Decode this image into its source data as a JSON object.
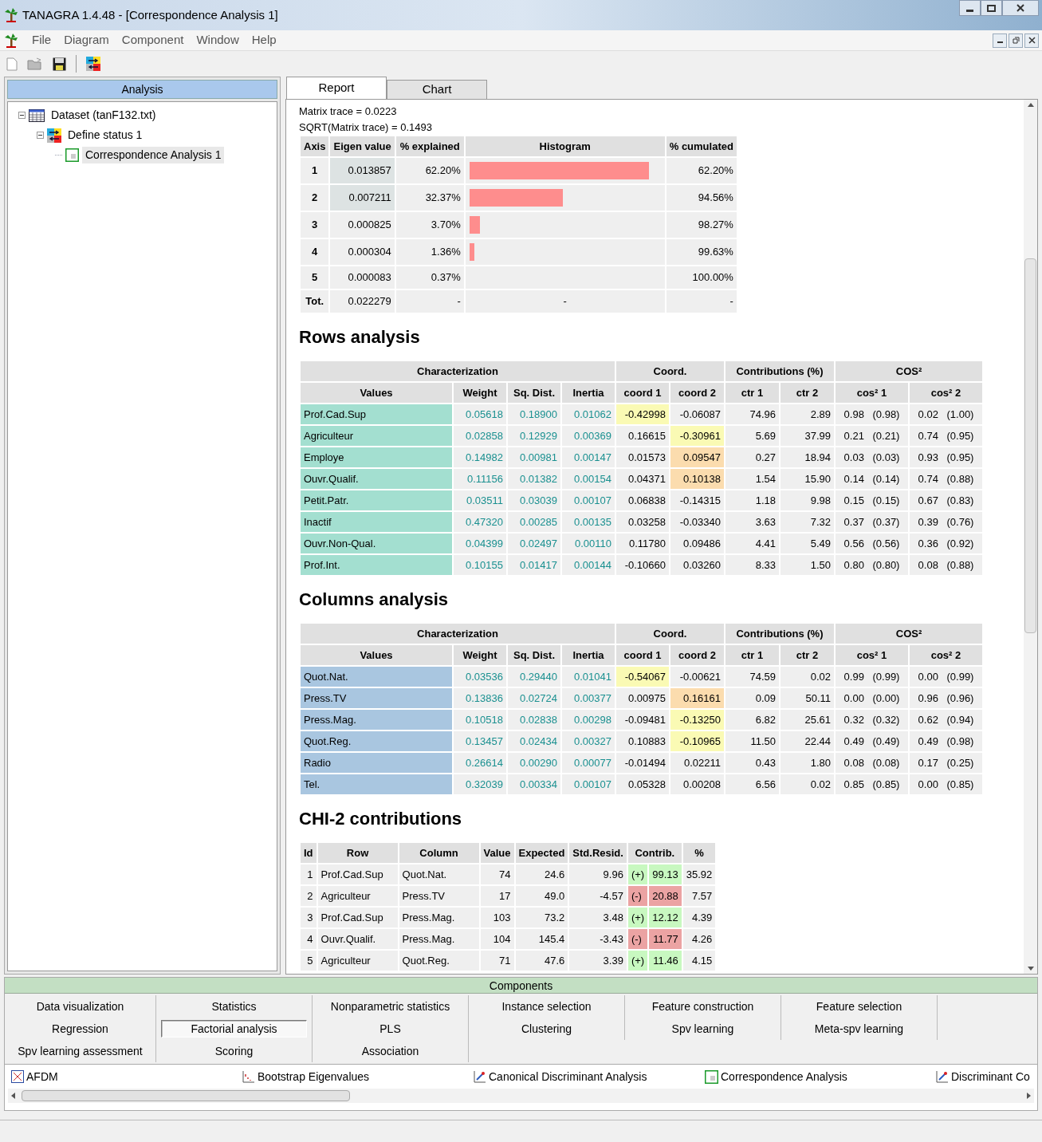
{
  "window": {
    "title": "TANAGRA 1.4.48 - [Correspondence Analysis 1]"
  },
  "menu": [
    "File",
    "Diagram",
    "Component",
    "Window",
    "Help"
  ],
  "tree": {
    "header": "Analysis",
    "items": [
      {
        "label": "Dataset (tanF132.txt)",
        "kind": "dataset",
        "selected": false,
        "expanded": true,
        "children": [
          {
            "label": "Define status 1",
            "kind": "status",
            "selected": false,
            "expanded": true,
            "children": [
              {
                "label": "Correspondence Analysis 1",
                "kind": "component",
                "selected": true
              }
            ]
          }
        ]
      }
    ]
  },
  "tabs": [
    {
      "label": "Report",
      "selected": true
    },
    {
      "label": "Chart",
      "selected": false
    }
  ],
  "report": {
    "trace_lines": [
      "Matrix trace = 0.0223",
      "SQRT(Matrix trace) = 0.1493"
    ],
    "eigen_table": {
      "columns": [
        "Axis",
        "Eigen value",
        "% explained",
        "Histogram",
        "% cumulated"
      ],
      "rows": [
        {
          "axis": "1",
          "eigen": "0.013857",
          "explained": "62.20%",
          "level": 0.94,
          "cumulated": "62.20%",
          "highlighted": true
        },
        {
          "axis": "2",
          "eigen": "0.007211",
          "explained": "32.37%",
          "level": 0.49,
          "cumulated": "94.56%",
          "highlighted": true
        },
        {
          "axis": "3",
          "eigen": "0.000825",
          "explained": "3.70%",
          "level": 0.056,
          "cumulated": "98.27%",
          "highlighted": false
        },
        {
          "axis": "4",
          "eigen": "0.000304",
          "explained": "1.36%",
          "level": 0.025,
          "cumulated": "99.63%",
          "highlighted": false
        },
        {
          "axis": "5",
          "eigen": "0.000083",
          "explained": "0.37%",
          "cumulated": "100.00%",
          "highlighted": false
        },
        {
          "axis": "Tot.",
          "eigen": "0.022279",
          "explained": "-",
          "histogram": "-",
          "cumulated": "-",
          "highlighted": false
        }
      ]
    },
    "analyses": [
      {
        "title": "Rows analysis",
        "kind": "rows",
        "groups": [
          "Characterization",
          "Coord.",
          "Contributions (%)",
          "COS²"
        ],
        "columns": [
          "Values",
          "Weight",
          "Sq. Dist.",
          "Inertia",
          "coord 1",
          "coord 2",
          "ctr 1",
          "ctr 2",
          "cos² 1",
          "cos² 2"
        ],
        "rows": [
          {
            "value": "Prof.Cad.Sup",
            "weight": "0.05618",
            "sq_dist": "0.18900",
            "inertia": "0.01062",
            "coord1": {
              "text": "-0.42998",
              "color": "#fafab4"
            },
            "coord2": {
              "text": "-0.06087"
            },
            "ctr1": "74.96",
            "ctr2": "2.89",
            "cos1": "0.98 (0.98)",
            "cos2": "0.02 (1.00)"
          },
          {
            "value": "Agriculteur",
            "weight": "0.02858",
            "sq_dist": "0.12929",
            "inertia": "0.00369",
            "coord1": {
              "text": "0.16615"
            },
            "coord2": {
              "text": "-0.30961",
              "color": "#fafab4"
            },
            "ctr1": "5.69",
            "ctr2": "37.99",
            "cos1": "0.21 (0.21)",
            "cos2": "0.74 (0.95)"
          },
          {
            "value": "Employe",
            "weight": "0.14982",
            "sq_dist": "0.00981",
            "inertia": "0.00147",
            "coord1": {
              "text": "0.01573"
            },
            "coord2": {
              "text": "0.09547",
              "color": "#fbdcae"
            },
            "ctr1": "0.27",
            "ctr2": "18.94",
            "cos1": "0.03 (0.03)",
            "cos2": "0.93 (0.95)"
          },
          {
            "value": "Ouvr.Qualif.",
            "weight": "0.11156",
            "sq_dist": "0.01382",
            "inertia": "0.00154",
            "coord1": {
              "text": "0.04371"
            },
            "coord2": {
              "text": "0.10138",
              "color": "#fbdcae"
            },
            "ctr1": "1.54",
            "ctr2": "15.90",
            "cos1": "0.14 (0.14)",
            "cos2": "0.74 (0.88)"
          },
          {
            "value": "Petit.Patr.",
            "weight": "0.03511",
            "sq_dist": "0.03039",
            "inertia": "0.00107",
            "coord1": {
              "text": "0.06838"
            },
            "coord2": {
              "text": "-0.14315"
            },
            "ctr1": "1.18",
            "ctr2": "9.98",
            "cos1": "0.15 (0.15)",
            "cos2": "0.67 (0.83)"
          },
          {
            "value": "Inactif",
            "weight": "0.47320",
            "sq_dist": "0.00285",
            "inertia": "0.00135",
            "coord1": {
              "text": "0.03258"
            },
            "coord2": {
              "text": "-0.03340"
            },
            "ctr1": "3.63",
            "ctr2": "7.32",
            "cos1": "0.37 (0.37)",
            "cos2": "0.39 (0.76)"
          },
          {
            "value": "Ouvr.Non-Qual.",
            "weight": "0.04399",
            "sq_dist": "0.02497",
            "inertia": "0.00110",
            "coord1": {
              "text": "0.11780"
            },
            "coord2": {
              "text": "0.09486"
            },
            "ctr1": "4.41",
            "ctr2": "5.49",
            "cos1": "0.56 (0.56)",
            "cos2": "0.36 (0.92)"
          },
          {
            "value": "Prof.Int.",
            "weight": "0.10155",
            "sq_dist": "0.01417",
            "inertia": "0.00144",
            "coord1": {
              "text": "-0.10660"
            },
            "coord2": {
              "text": "0.03260"
            },
            "ctr1": "8.33",
            "ctr2": "1.50",
            "cos1": "0.80 (0.80)",
            "cos2": "0.08 (0.88)"
          }
        ]
      },
      {
        "title": "Columns analysis",
        "kind": "columns",
        "groups": [
          "Characterization",
          "Coord.",
          "Contributions (%)",
          "COS²"
        ],
        "columns": [
          "Values",
          "Weight",
          "Sq. Dist.",
          "Inertia",
          "coord 1",
          "coord 2",
          "ctr 1",
          "ctr 2",
          "cos² 1",
          "cos² 2"
        ],
        "rows": [
          {
            "value": "Quot.Nat.",
            "weight": "0.03536",
            "sq_dist": "0.29440",
            "inertia": "0.01041",
            "coord1": {
              "text": "-0.54067",
              "color": "#fafab4"
            },
            "coord2": {
              "text": "-0.00621"
            },
            "ctr1": "74.59",
            "ctr2": "0.02",
            "cos1": "0.99 (0.99)",
            "cos2": "0.00 (0.99)"
          },
          {
            "value": "Press.TV",
            "weight": "0.13836",
            "sq_dist": "0.02724",
            "inertia": "0.00377",
            "coord1": {
              "text": "0.00975"
            },
            "coord2": {
              "text": "0.16161",
              "color": "#fbdcae"
            },
            "ctr1": "0.09",
            "ctr2": "50.11",
            "cos1": "0.00 (0.00)",
            "cos2": "0.96 (0.96)"
          },
          {
            "value": "Press.Mag.",
            "weight": "0.10518",
            "sq_dist": "0.02838",
            "inertia": "0.00298",
            "coord1": {
              "text": "-0.09481"
            },
            "coord2": {
              "text": "-0.13250",
              "color": "#fafab4"
            },
            "ctr1": "6.82",
            "ctr2": "25.61",
            "cos1": "0.32 (0.32)",
            "cos2": "0.62 (0.94)"
          },
          {
            "value": "Quot.Reg.",
            "weight": "0.13457",
            "sq_dist": "0.02434",
            "inertia": "0.00327",
            "coord1": {
              "text": "0.10883"
            },
            "coord2": {
              "text": "-0.10965",
              "color": "#fafab4"
            },
            "ctr1": "11.50",
            "ctr2": "22.44",
            "cos1": "0.49 (0.49)",
            "cos2": "0.49 (0.98)"
          },
          {
            "value": "Radio",
            "weight": "0.26614",
            "sq_dist": "0.00290",
            "inertia": "0.00077",
            "coord1": {
              "text": "-0.01494"
            },
            "coord2": {
              "text": "0.02211"
            },
            "ctr1": "0.43",
            "ctr2": "1.80",
            "cos1": "0.08 (0.08)",
            "cos2": "0.17 (0.25)"
          },
          {
            "value": "Tel.",
            "weight": "0.32039",
            "sq_dist": "0.00334",
            "inertia": "0.00107",
            "coord1": {
              "text": "0.05328"
            },
            "coord2": {
              "text": "0.00208"
            },
            "ctr1": "6.56",
            "ctr2": "0.02",
            "cos1": "0.85 (0.85)",
            "cos2": "0.00 (0.85)"
          }
        ]
      }
    ],
    "chi2": {
      "title": "CHI-2 contributions",
      "columns": [
        "Id",
        "Row",
        "Column",
        "Value",
        "Expected",
        "Std.Resid.",
        "Contrib.",
        "%"
      ],
      "rows": [
        {
          "id": "1",
          "row": "Prof.Cad.Sup",
          "column": "Quot.Nat.",
          "value": "74",
          "expected": "24.6",
          "resid": "9.96",
          "sign": "(+)",
          "positive": true,
          "contrib": "99.13",
          "pct": "35.92"
        },
        {
          "id": "2",
          "row": "Agriculteur",
          "column": "Press.TV",
          "value": "17",
          "expected": "49.0",
          "resid": "-4.57",
          "sign": "(-)",
          "positive": false,
          "contrib": "20.88",
          "pct": "7.57"
        },
        {
          "id": "3",
          "row": "Prof.Cad.Sup",
          "column": "Press.Mag.",
          "value": "103",
          "expected": "73.2",
          "resid": "3.48",
          "sign": "(+)",
          "positive": true,
          "contrib": "12.12",
          "pct": "4.39"
        },
        {
          "id": "4",
          "row": "Ouvr.Qualif.",
          "column": "Press.Mag.",
          "value": "104",
          "expected": "145.4",
          "resid": "-3.43",
          "sign": "(-)",
          "positive": false,
          "contrib": "11.77",
          "pct": "4.26"
        },
        {
          "id": "5",
          "row": "Agriculteur",
          "column": "Quot.Reg.",
          "value": "71",
          "expected": "47.6",
          "resid": "3.39",
          "sign": "(+)",
          "positive": true,
          "contrib": "11.46",
          "pct": "4.15"
        }
      ]
    }
  },
  "components": {
    "header": "Components",
    "tabs": [
      {
        "label": "Data visualization",
        "selected": false
      },
      {
        "label": "Statistics",
        "selected": false
      },
      {
        "label": "Nonparametric statistics",
        "selected": false
      },
      {
        "label": "Instance selection",
        "selected": false
      },
      {
        "label": "Feature construction",
        "selected": false
      },
      {
        "label": "Feature selection",
        "selected": false
      },
      {
        "label": "Regression",
        "selected": false
      },
      {
        "label": "Factorial analysis",
        "selected": true
      },
      {
        "label": "PLS",
        "selected": false
      },
      {
        "label": "Clustering",
        "selected": false
      },
      {
        "label": "Spv learning",
        "selected": false
      },
      {
        "label": "Meta-spv learning",
        "selected": false
      },
      {
        "label": "Spv learning assessment",
        "selected": false
      },
      {
        "label": "Scoring",
        "selected": false
      },
      {
        "label": "Association",
        "selected": false
      }
    ],
    "items": [
      {
        "label": "AFDM",
        "kind": "afdm"
      },
      {
        "label": "Bootstrap Eigenvalues",
        "kind": "bootstrap"
      },
      {
        "label": "Canonical Discriminant Analysis",
        "kind": "pen"
      },
      {
        "label": "Correspondence Analysis",
        "kind": "component"
      },
      {
        "label": "Discriminant Co",
        "kind": "pen"
      }
    ]
  }
}
